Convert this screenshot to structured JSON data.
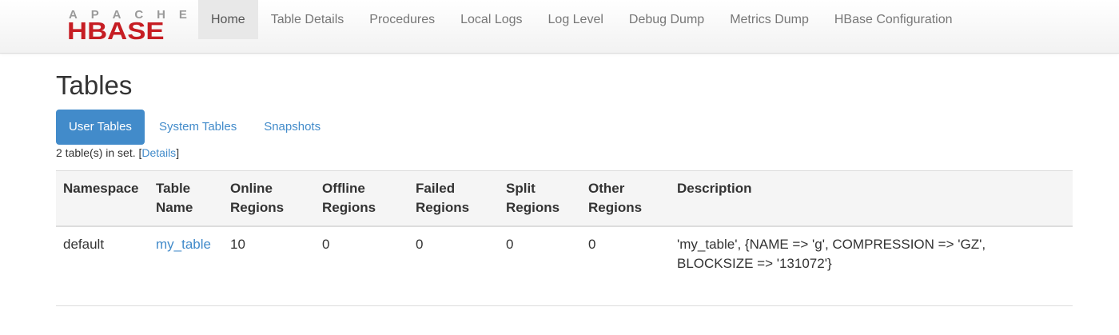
{
  "logo": {
    "top_letters": [
      "A",
      "P",
      "A",
      "C",
      "H",
      "E"
    ],
    "main_text": "HBASE",
    "colors": {
      "top": "#9a9a9a",
      "main": "#c61d23"
    }
  },
  "nav": {
    "items": [
      {
        "label": "Home"
      },
      {
        "label": "Table Details"
      },
      {
        "label": "Procedures"
      },
      {
        "label": "Local Logs"
      },
      {
        "label": "Log Level"
      },
      {
        "label": "Debug Dump"
      },
      {
        "label": "Metrics Dump"
      },
      {
        "label": "HBase Configuration"
      }
    ],
    "active": "Home"
  },
  "page": {
    "title": "Tables"
  },
  "tabs": [
    {
      "label": "User Tables"
    },
    {
      "label": "System Tables"
    },
    {
      "label": "Snapshots"
    }
  ],
  "active_tab": "User Tables",
  "summary": {
    "prefix": "2 table(s) in set. [",
    "link": "Details",
    "suffix": "]"
  },
  "table": {
    "headers": [
      {
        "line1": "Namespace",
        "line2": ""
      },
      {
        "line1": "Table",
        "line2": "Name"
      },
      {
        "line1": "Online",
        "line2": "Regions"
      },
      {
        "line1": "Offline",
        "line2": "Regions"
      },
      {
        "line1": "Failed",
        "line2": "Regions"
      },
      {
        "line1": "Split",
        "line2": "Regions"
      },
      {
        "line1": "Other",
        "line2": "Regions"
      },
      {
        "line1": "Description",
        "line2": ""
      }
    ],
    "rows": [
      {
        "namespace": "default",
        "table_name": "my_table",
        "online": "10",
        "offline": "0",
        "failed": "0",
        "split": "0",
        "other": "0",
        "description_line1": "'my_table', {NAME => 'g', COMPRESSION => 'GZ',",
        "description_line2": "BLOCKSIZE => '131072'}"
      }
    ]
  },
  "colors": {
    "link": "#428bca",
    "active_tab_bg": "#428bca"
  }
}
